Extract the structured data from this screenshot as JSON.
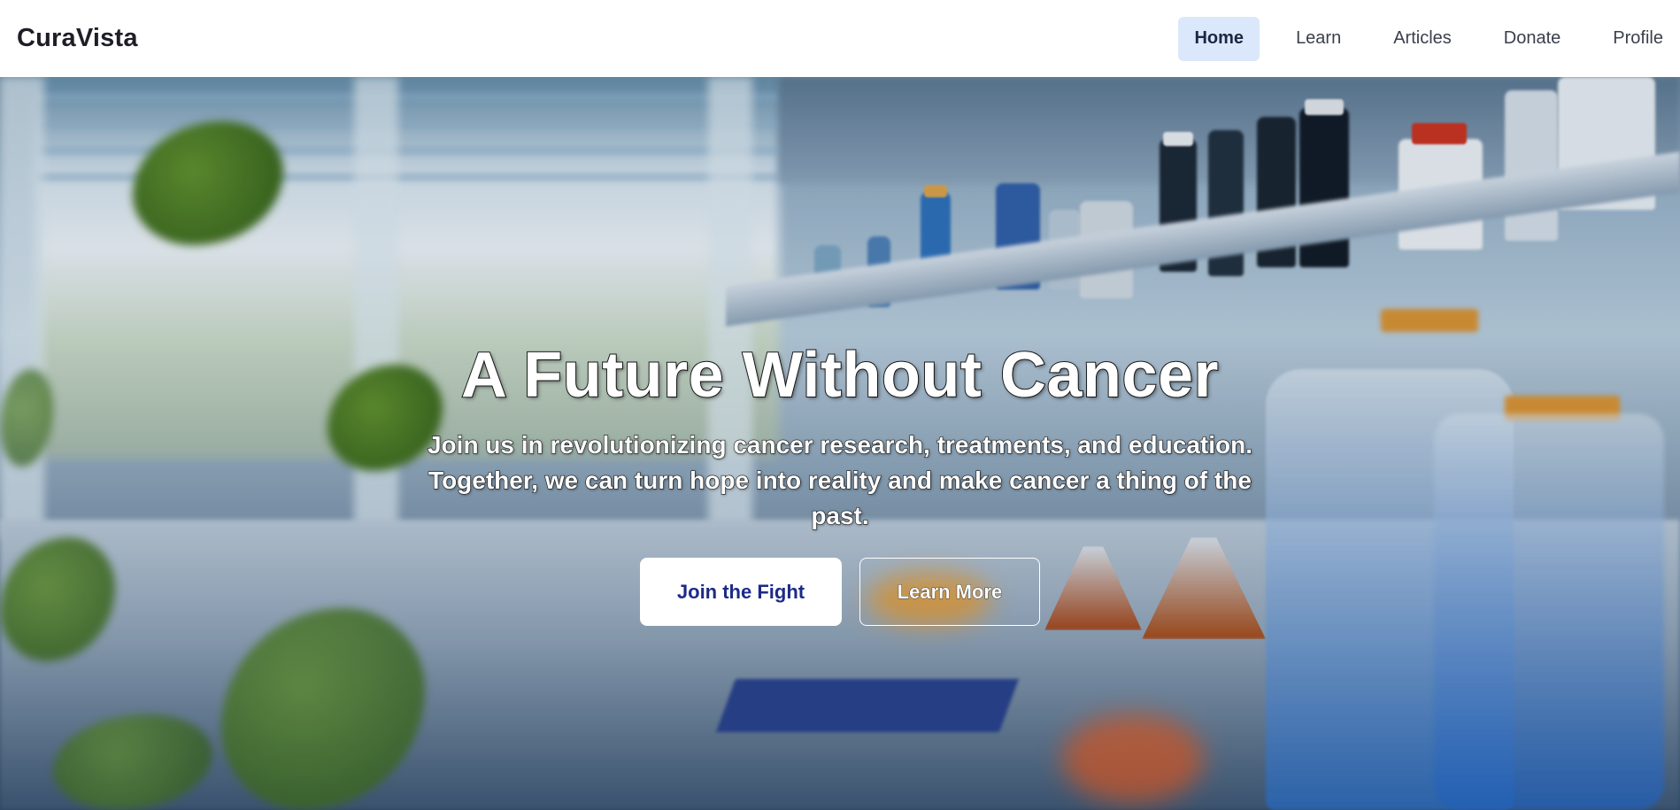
{
  "header": {
    "brand": "CuraVista",
    "nav": [
      {
        "label": "Home",
        "active": true
      },
      {
        "label": "Learn",
        "active": false
      },
      {
        "label": "Articles",
        "active": false
      },
      {
        "label": "Donate",
        "active": false
      },
      {
        "label": "Profile",
        "active": false
      }
    ]
  },
  "hero": {
    "title": "A Future Without Cancer",
    "subtitle": "Join us in revolutionizing cancer research, treatments, and education. Together, we can turn hope into reality and make cancer a thing of the past.",
    "primary_button": "Join the Fight",
    "secondary_button": "Learn More",
    "background": "laboratory-background-image"
  },
  "colors": {
    "active_nav_bg": "#dbe8fb",
    "primary_button_text": "#1c2a88",
    "brand_text": "#1e1e28"
  }
}
